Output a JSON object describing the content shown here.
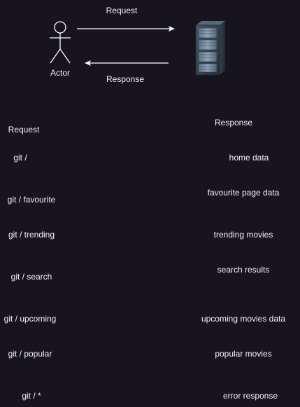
{
  "diagram": {
    "request_arrow_label": "Request",
    "response_arrow_label": "Response",
    "actor_label": "Actor",
    "server_icon": "server-rack-icon"
  },
  "table": {
    "request_header": "Request",
    "response_header": "Response",
    "rows": [
      {
        "request": "git /",
        "response": "home data"
      },
      {
        "request": "git / favourite",
        "response": "favourite page data"
      },
      {
        "request": "git / trending",
        "response": "trending movies"
      },
      {
        "request": "git / search",
        "response": "search results"
      },
      {
        "request": "git / upcoming",
        "response": "upcoming movies data"
      },
      {
        "request": "git / popular",
        "response": "popular movies"
      },
      {
        "request": "git / *",
        "response": "error response"
      }
    ]
  },
  "colors": {
    "background": "#18141d",
    "line": "#ffffff",
    "text": "#f2f2f2"
  }
}
